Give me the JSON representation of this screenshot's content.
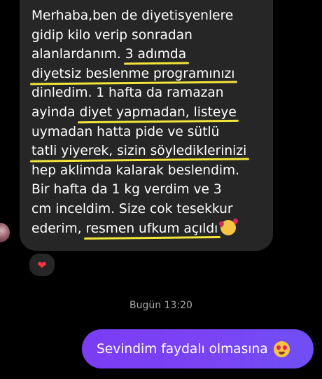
{
  "incoming_message": {
    "lines": [
      [
        {
          "t": "Merhaba,ben de diyetisyenlere",
          "u": false
        }
      ],
      [
        {
          "t": "gidip kilo verip sonradan",
          "u": false
        }
      ],
      [
        {
          "t": "alanlardanım. ",
          "u": false
        },
        {
          "t": "3 adımda",
          "u": true
        }
      ],
      [
        {
          "t": "diyetsiz beslenme programınızı",
          "u": true
        }
      ],
      [
        {
          "t": "dinledim. 1 hafta da ramazan",
          "u": false
        }
      ],
      [
        {
          "t": "ayinda ",
          "u": false
        },
        {
          "t": "diyet yapmadan, listeye",
          "u": true
        }
      ],
      [
        {
          "t": "uymadan hatta pide ve sütlü",
          "u": false
        }
      ],
      [
        {
          "t": "tatli yiyerek, sizin söylediklerinizi",
          "u": true
        }
      ],
      [
        {
          "t": "hep aklimda kalarak beslendim.",
          "u": false
        }
      ],
      [
        {
          "t": "Bir hafta da  1 kg verdim ve 3",
          "u": false
        }
      ],
      [
        {
          "t": "cm inceldim. Size cok tesekkur",
          "u": false
        }
      ],
      [
        {
          "t": "ederim,  ",
          "u": false
        },
        {
          "t": "resmen ufkum açıldı",
          "u": true
        }
      ]
    ],
    "emoji": "smiling-face-with-hearts",
    "reaction": "❤"
  },
  "timestamp": "Bugün 13:20",
  "outgoing_message": {
    "text": "Sevindim faydalı olmasına",
    "emoji": "heart-eyes"
  },
  "colors": {
    "background": "#000000",
    "incoming_bubble": "#262626",
    "outgoing_bubble": "#7a45f5",
    "underline": "#f2e53a",
    "timestamp": "#a8a8a8"
  }
}
